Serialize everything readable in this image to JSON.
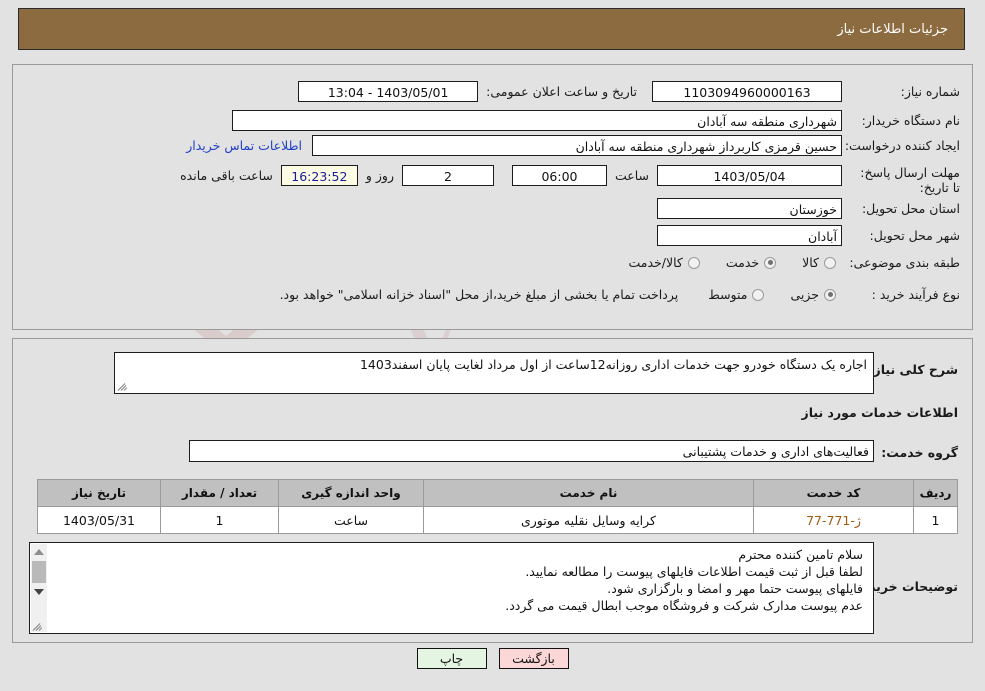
{
  "header": {
    "title": "جزئیات اطلاعات نیاز"
  },
  "basic": {
    "need_number_label": "شماره نیاز:",
    "need_number_value": "1103094960000163",
    "announce_label": "تاریخ و ساعت اعلان عمومی:",
    "announce_value": "1403/05/01 - 13:04",
    "buyer_org_label": "نام دستگاه خریدار:",
    "buyer_org_value": "شهرداری منطقه سه آبادان",
    "creator_label": "ایجاد کننده درخواست:",
    "creator_value": "حسین قرمزی کاربرداز شهرداری منطقه سه آبادان",
    "contact_link": "اطلاعات تماس خریدار",
    "deadline_label": "مهلت ارسال پاسخ: تا تاریخ:",
    "deadline_date": "1403/05/04",
    "hour_label": "ساعت",
    "deadline_time": "06:00",
    "days_value": "2",
    "days_label": "روز و",
    "countdown_value": "16:23:52",
    "remaining_label": "ساعت باقی مانده",
    "province_label": "استان محل تحویل:",
    "province_value": "خوزستان",
    "city_label": "شهر محل تحویل:",
    "city_value": "آبادان",
    "category_label": "طبقه بندی موضوعی:",
    "category_options": [
      {
        "label": "کالا",
        "selected": false
      },
      {
        "label": "خدمت",
        "selected": true
      },
      {
        "label": "کالا/خدمت",
        "selected": false
      }
    ],
    "process_label": "نوع فرآیند خرید :",
    "process_options": [
      {
        "label": "جزیی",
        "selected": true
      },
      {
        "label": "متوسط",
        "selected": false
      }
    ],
    "payment_note": "پرداخت تمام یا بخشی از مبلغ خرید،از محل \"اسناد خزانه اسلامی\" خواهد بود."
  },
  "detail": {
    "summary_label": "شرح کلی نیاز:",
    "summary_value": "اجاره یک دستگاه خودرو جهت خدمات اداری روزانه12ساعت از اول مرداد لغایت پایان اسفند1403",
    "services_heading": "اطلاعات خدمات مورد نیاز",
    "service_group_label": "گروه خدمت:",
    "service_group_value": "فعالیت‌های اداری و خدمات پشتیبانی",
    "table": {
      "columns": [
        "ردیف",
        "کد خدمت",
        "نام خدمت",
        "واحد اندازه گیری",
        "تعداد / مقدار",
        "تاریخ نیاز"
      ],
      "rows": [
        {
          "row": "1",
          "code": "ژ-771-77",
          "name": "کرایه وسایل نقلیه موتوری",
          "unit": "ساعت",
          "qty": "1",
          "date": "1403/05/31"
        }
      ]
    },
    "notes_label": "توضیحات خریدار:",
    "notes_lines": [
      "سلام تامین کننده محترم",
      "لطفا قبل از ثبت قیمت اطلاعات فایلهای پیوست را مطالعه نمایید.",
      "فایلهای پیوست حتما مهر و امضا و بارگزاری شود.",
      "عدم پیوست مدارک شرکت و فروشگاه موجب ابطال قیمت می گردد."
    ]
  },
  "footer": {
    "back_label": "بازگشت",
    "print_label": "چاپ"
  },
  "watermark": {
    "text": "AriaTender.net"
  },
  "colors": {
    "header_bar": "#8b6b3f",
    "page_background": "#e2e2e2",
    "table_header": "#c0c0c0",
    "link": "#1f3fc8",
    "countdown_text": "#1a1a9a",
    "countdown_bg": "#fbfbe4",
    "service_code": "#a05a12",
    "back_button": "#fcd7d7",
    "print_button": "#e4f6e1"
  }
}
